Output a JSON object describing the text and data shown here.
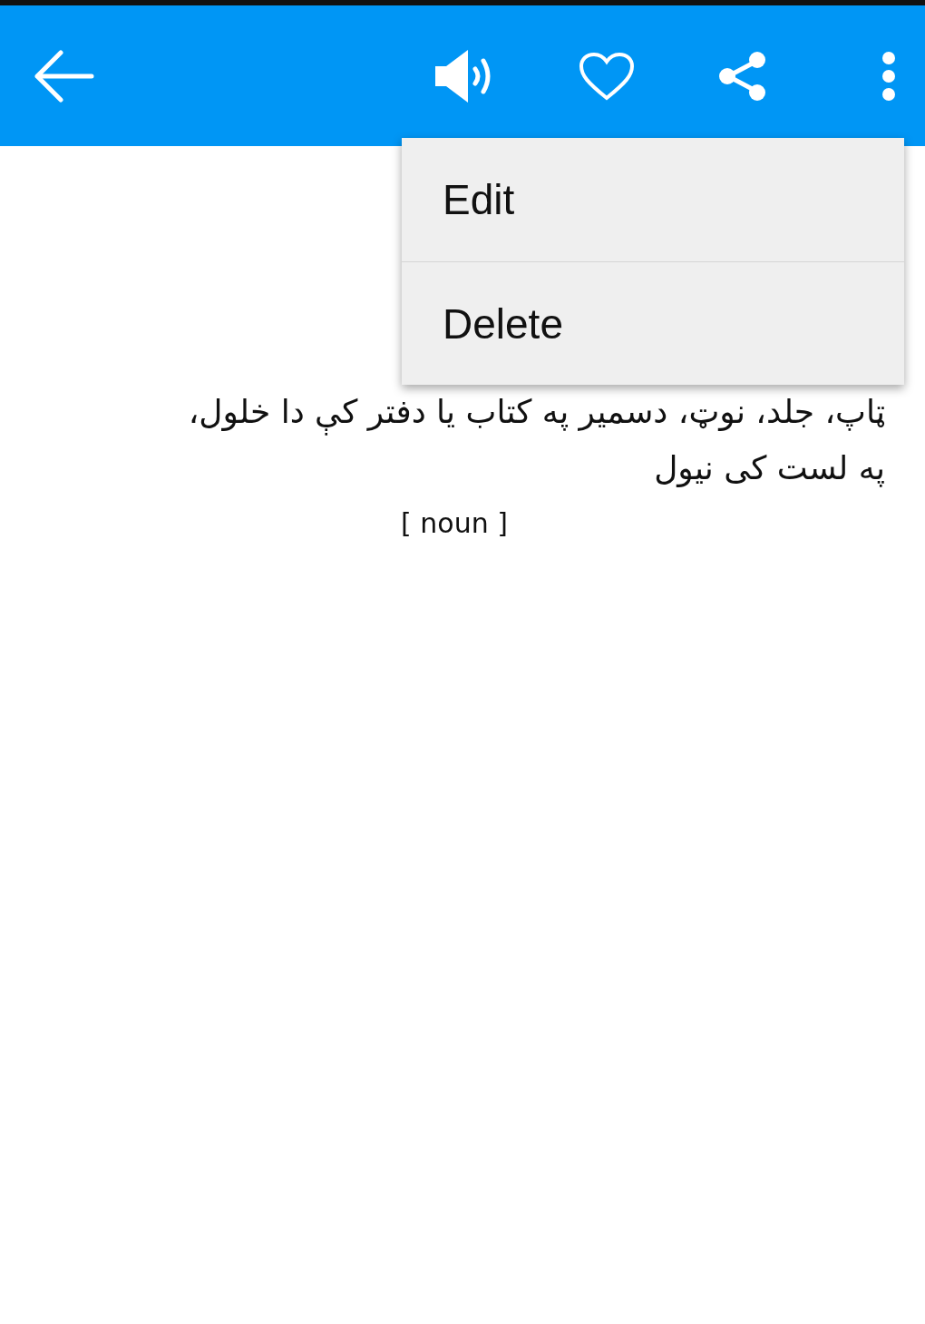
{
  "definition": {
    "lines": [
      "ټاپ، جلد، نوټ، دسمیر په کتاب یا دفتر کې دا خلول،",
      "په لست کی نیول"
    ],
    "part_of_speech": "[ noun ]"
  },
  "menu": {
    "items": [
      {
        "label": "Edit"
      },
      {
        "label": "Delete"
      }
    ]
  }
}
